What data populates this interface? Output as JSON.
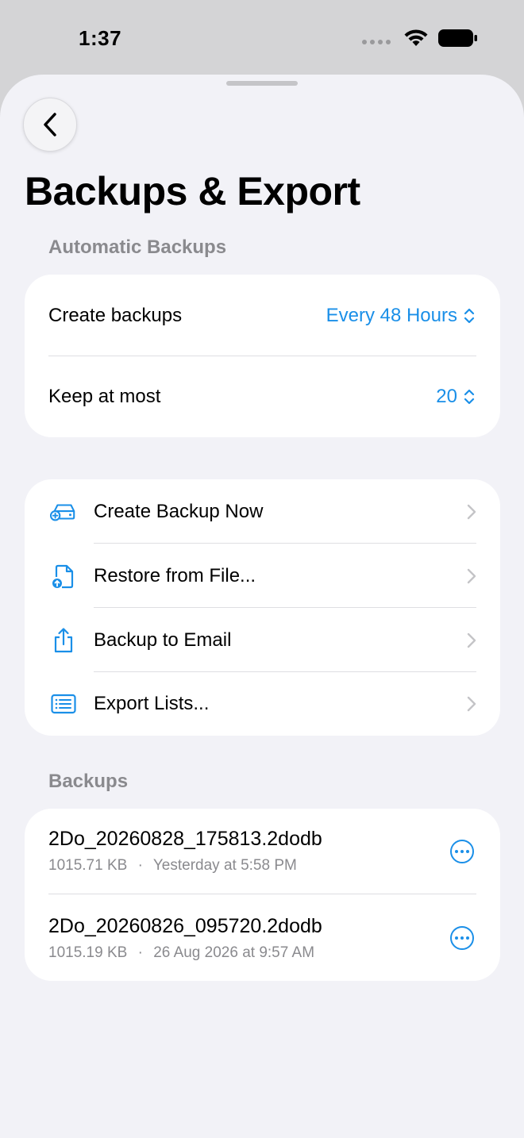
{
  "status_bar": {
    "time": "1:37"
  },
  "page": {
    "title": "Backups & Export"
  },
  "automatic_backups": {
    "header": "Automatic Backups",
    "create_backups": {
      "label": "Create backups",
      "value": "Every 48 Hours"
    },
    "keep_at_most": {
      "label": "Keep at most",
      "value": "20"
    }
  },
  "actions": [
    {
      "label": "Create Backup Now",
      "icon": "add-backup-icon"
    },
    {
      "label": "Restore from File...",
      "icon": "restore-file-icon"
    },
    {
      "label": "Backup to Email",
      "icon": "share-icon"
    },
    {
      "label": "Export Lists...",
      "icon": "list-icon"
    }
  ],
  "backups": {
    "header": "Backups",
    "items": [
      {
        "name": "2Do_20260828_175813.2dodb",
        "size": "1015.71 KB",
        "date": "Yesterday at 5:58 PM"
      },
      {
        "name": "2Do_20260826_095720.2dodb",
        "size": "1015.19 KB",
        "date": "26 Aug 2026 at 9:57 AM"
      }
    ],
    "separator": "·"
  },
  "colors": {
    "accent": "#1a8fe8",
    "background": "#f2f2f7",
    "secondary_text": "#8a8a8e"
  }
}
